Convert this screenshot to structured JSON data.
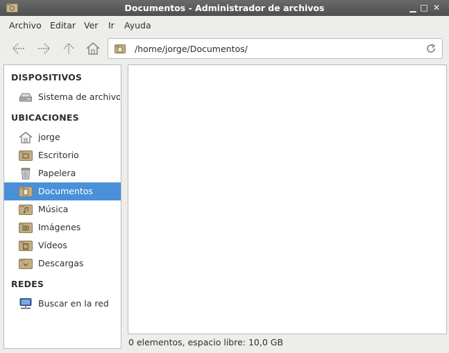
{
  "window": {
    "title": "Documentos - Administrador de archivos",
    "minimize": "▁",
    "maximize": "□",
    "close": "✕"
  },
  "menu": [
    {
      "label": "Archivo"
    },
    {
      "label": "Editar"
    },
    {
      "label": "Ver"
    },
    {
      "label": "Ir"
    },
    {
      "label": "Ayuda"
    }
  ],
  "location": {
    "path": "/home/jorge/Documentos/"
  },
  "sidebar": {
    "devices_heading": "DISPOSITIVOS",
    "devices": [
      {
        "label": "Sistema de archivos",
        "icon": "drive-icon"
      }
    ],
    "places_heading": "UBICACIONES",
    "places": [
      {
        "label": "jorge",
        "icon": "home-icon"
      },
      {
        "label": "Escritorio",
        "icon": "desktop-folder-icon"
      },
      {
        "label": "Papelera",
        "icon": "trash-icon"
      },
      {
        "label": "Documentos",
        "icon": "documents-folder-icon",
        "selected": true
      },
      {
        "label": "Música",
        "icon": "music-folder-icon"
      },
      {
        "label": "Imágenes",
        "icon": "pictures-folder-icon"
      },
      {
        "label": "Vídeos",
        "icon": "videos-folder-icon"
      },
      {
        "label": "Descargas",
        "icon": "downloads-folder-icon"
      }
    ],
    "network_heading": "REDES",
    "network": [
      {
        "label": "Buscar en la red",
        "icon": "network-icon"
      }
    ]
  },
  "status": {
    "text": "0 elementos, espacio libre: 10,0 GB"
  },
  "colors": {
    "selection": "#4a90d9",
    "folder": "#b59f73",
    "titlebar": "#5a5a5a"
  }
}
